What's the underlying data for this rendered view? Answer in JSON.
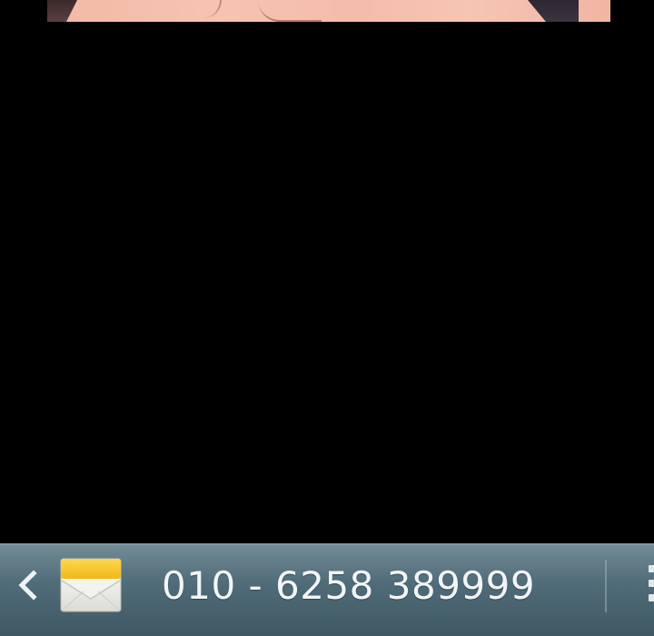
{
  "message_bar": {
    "phone_number": "010 - 6258 389999",
    "back_icon": "chevron-left-icon",
    "mail_icon": "envelope-icon",
    "menu_icon": "overflow-menu-icon"
  },
  "colors": {
    "background": "#000000",
    "bar_top": "#627e89",
    "bar_bottom": "#3f5964",
    "text": "#f2f5f7",
    "envelope": "#f3f3ef",
    "envelope_flap": "#f6c62a"
  }
}
